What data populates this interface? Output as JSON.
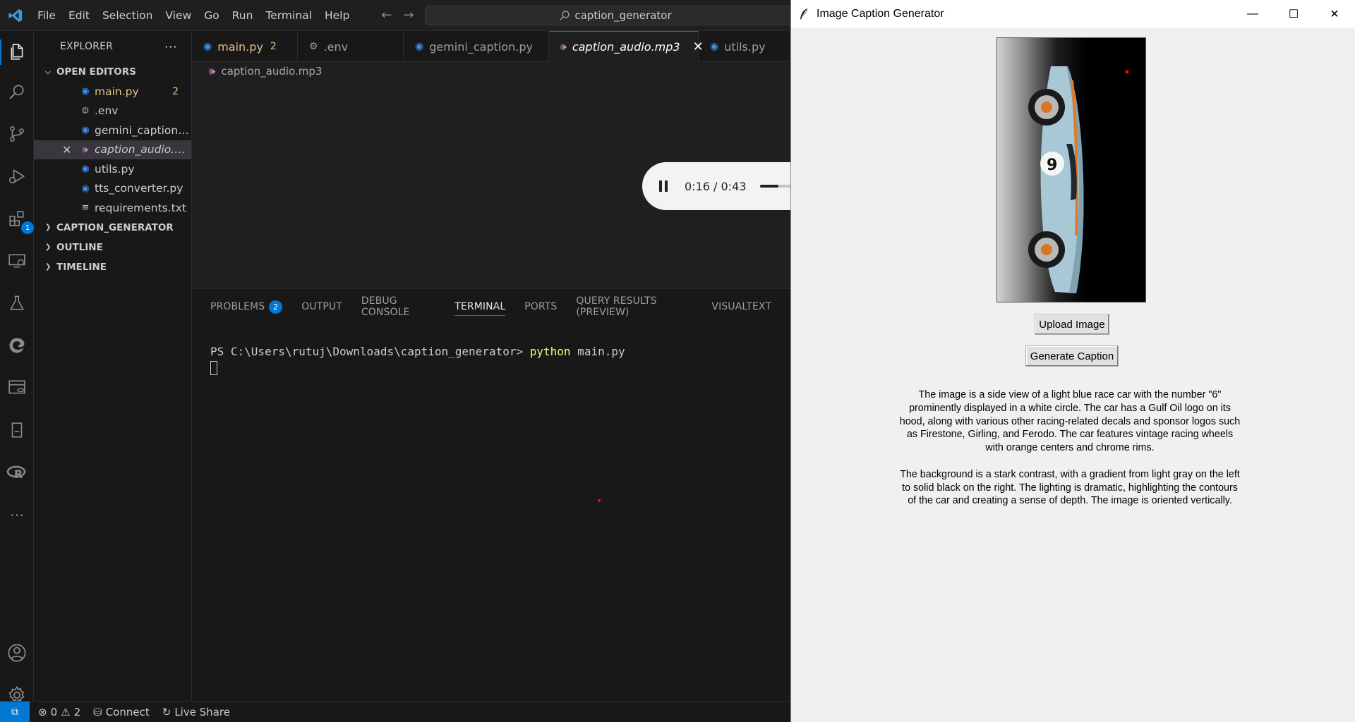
{
  "menu": [
    "File",
    "Edit",
    "Selection",
    "View",
    "Go",
    "Run",
    "Terminal",
    "Help"
  ],
  "search": {
    "text": "caption_generator"
  },
  "activity": {
    "extensions_badge": "1"
  },
  "explorer": {
    "title": "EXPLORER",
    "open_editors_label": "OPEN EDITORS",
    "open_editors": [
      {
        "name": "main.py",
        "count": "2"
      },
      {
        "name": ".env"
      },
      {
        "name": "gemini_caption.py"
      },
      {
        "name": "caption_audio.m..."
      },
      {
        "name": "utils.py"
      },
      {
        "name": "tts_converter.py"
      },
      {
        "name": "requirements.txt"
      }
    ],
    "sections": [
      "CAPTION_GENERATOR",
      "OUTLINE",
      "TIMELINE"
    ]
  },
  "tabs": [
    {
      "label": "main.py",
      "mark": "2"
    },
    {
      "label": ".env"
    },
    {
      "label": "gemini_caption.py"
    },
    {
      "label": "caption_audio.mp3"
    },
    {
      "label": "utils.py"
    }
  ],
  "breadcrumb": "caption_audio.mp3",
  "audio": {
    "time": "0:16 / 0:43",
    "progress": 0.372
  },
  "panel": {
    "tabs": [
      "PROBLEMS",
      "OUTPUT",
      "DEBUG CONSOLE",
      "TERMINAL",
      "PORTS",
      "QUERY RESULTS (PREVIEW)",
      "VISUALTEXT"
    ],
    "problems_badge": "2",
    "terminal_prompt": "PS C:\\Users\\rutuj\\Downloads\\caption_generator> ",
    "terminal_cmd": "python",
    "terminal_args": " main.py"
  },
  "statusbar": {
    "errors": "0",
    "warnings": "2",
    "connect": "Connect",
    "live_share": "Live Share"
  },
  "tk": {
    "title": "Image Caption Generator",
    "upload_label": "Upload Image",
    "generate_label": "Generate Caption",
    "caption_p1": "The image is a side view of a light blue race car with the number \"6\" prominently displayed in a white circle. The car has a Gulf Oil logo on its hood, along with various other racing-related decals and sponsor logos such as Firestone, Girling, and Ferodo. The car features vintage racing wheels with orange centers and chrome rims.",
    "caption_p2": "The background is a stark contrast, with a gradient from light gray on the left to solid black on the right. The lighting is dramatic, highlighting the contours of the car and creating a sense of depth. The image is oriented vertically.",
    "car_number": "9"
  }
}
